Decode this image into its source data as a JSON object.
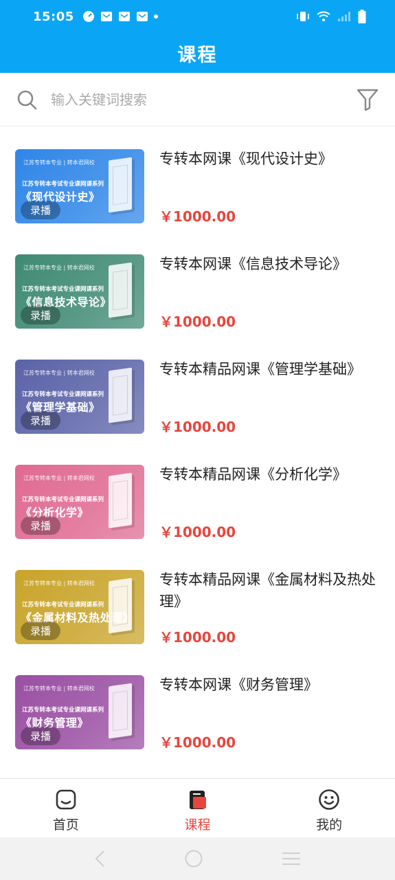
{
  "status": {
    "time": "15:05"
  },
  "header": {
    "title": "课程"
  },
  "search": {
    "placeholder": "输入关键词搜索"
  },
  "colors": {
    "accent": "#0aa6f5",
    "price": "#e8453c"
  },
  "thumb_common": {
    "header_text": "江苏专转本专业 | 转本君网校",
    "sub_text": "江苏专转本考试专业课网课系列",
    "badge": "录播"
  },
  "courses": [
    {
      "name": "专转本网课《现代设计史》",
      "price": "￥1000.00",
      "cover_title": "《现代设计史》",
      "color": "#2f86e8"
    },
    {
      "name": "专转本网课《信息技术导论》",
      "price": "￥1000.00",
      "cover_title": "《信息技术导论》",
      "color": "#3f8a73"
    },
    {
      "name": "专转本精品网课《管理学基础》",
      "price": "￥1000.00",
      "cover_title": "《管理学基础》",
      "color": "#5b63a8"
    },
    {
      "name": "专转本精品网课《分析化学》",
      "price": "￥1000.00",
      "cover_title": "《分析化学》",
      "color": "#e06a92"
    },
    {
      "name": "专转本精品网课《金属材料及热处理》",
      "price": "￥1000.00",
      "cover_title": "《金属材料及热处理》",
      "color": "#c9a42a"
    },
    {
      "name": "专转本网课《财务管理》",
      "price": "￥1000.00",
      "cover_title": "《财务管理》",
      "color": "#9a4fa3"
    }
  ],
  "nav": {
    "home": "首页",
    "courses": "课程",
    "mine": "我的"
  }
}
